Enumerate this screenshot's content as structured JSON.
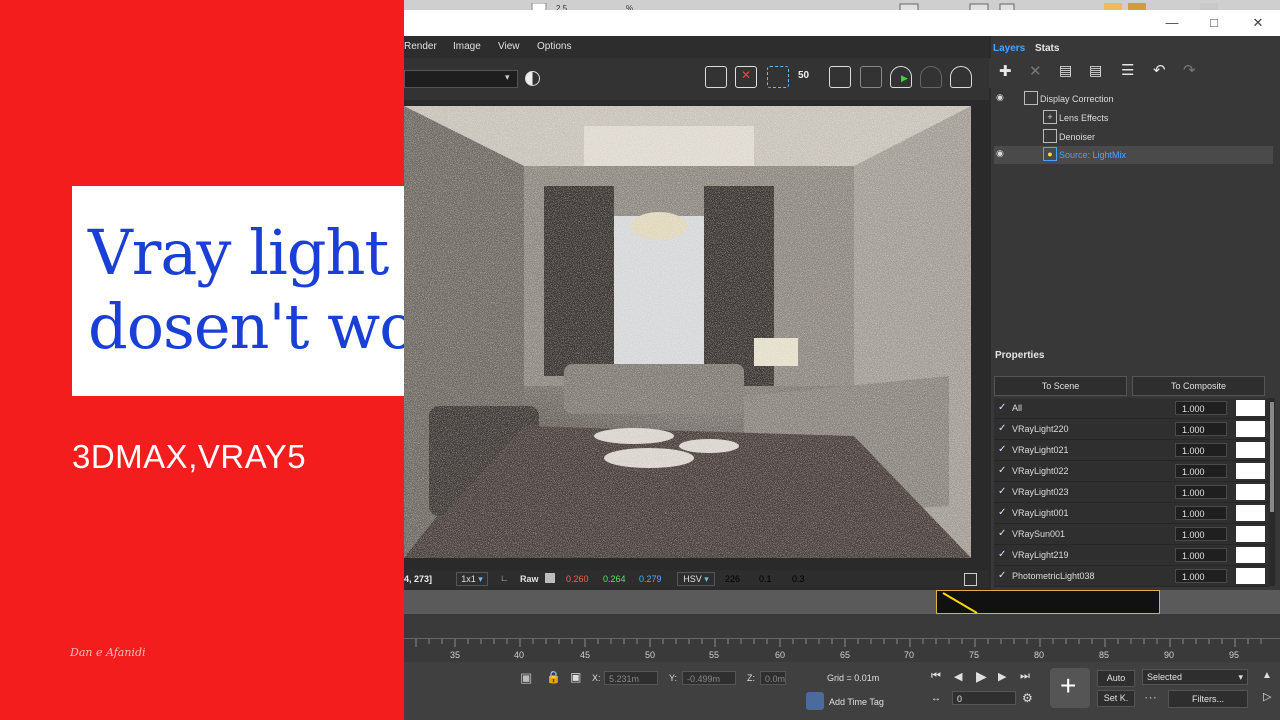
{
  "title": {
    "line1": "Vray light mix",
    "line2": "dosen't work",
    "subtitle": "3DMAX,VRAY5",
    "signature": "Dan e Afanidi"
  },
  "vfb": {
    "menu": [
      "Render",
      "Image",
      "View",
      "Options"
    ],
    "toolbar_badge": "50",
    "status": {
      "coords": "4, 273]",
      "ratio": "1x1",
      "raw_label": "Raw",
      "r": "0.260",
      "g": "0.264",
      "b": "0.279",
      "mode": "HSV",
      "h": "226",
      "s": "0.1",
      "v": "0.3"
    }
  },
  "layers": {
    "tabs": [
      "Layers",
      "Stats"
    ],
    "items": [
      {
        "label": "Display Correction"
      },
      {
        "label": "Lens Effects"
      },
      {
        "label": "Denoiser"
      },
      {
        "label": "Source: LightMix"
      }
    ]
  },
  "properties": {
    "title": "Properties",
    "to_scene": "To Scene",
    "to_composite": "To Composite",
    "rows": [
      {
        "name": "All",
        "value": "1.000"
      },
      {
        "name": "VRayLight220",
        "value": "1.000"
      },
      {
        "name": "VRayLight021",
        "value": "1.000"
      },
      {
        "name": "VRayLight022",
        "value": "1.000"
      },
      {
        "name": "VRayLight023",
        "value": "1.000"
      },
      {
        "name": "VRayLight001",
        "value": "1.000"
      },
      {
        "name": "VRaySun001",
        "value": "1.000"
      },
      {
        "name": "VRayLight219",
        "value": "1.000"
      },
      {
        "name": "PhotometricLight038",
        "value": "1.000"
      }
    ]
  },
  "timeline": {
    "ticks": [
      "35",
      "40",
      "45",
      "50",
      "55",
      "60",
      "65",
      "70",
      "75",
      "80",
      "85",
      "90",
      "95"
    ]
  },
  "bottom": {
    "x_label": "X:",
    "x_value": "5.231m",
    "y_label": "Y:",
    "y_value": "-0.499m",
    "z_label": "Z:",
    "z_value": "0.0m",
    "grid": "Grid = 0.01m",
    "add_time_tag": "Add Time Tag",
    "frame": "0",
    "auto": "Auto",
    "set_key": "Set K.",
    "selected": "Selected",
    "filters": "Filters..."
  },
  "colors": {
    "red_panel": "#f41d1d",
    "title_blue": "#1a3fd6",
    "accent_blue": "#4da3ff"
  }
}
